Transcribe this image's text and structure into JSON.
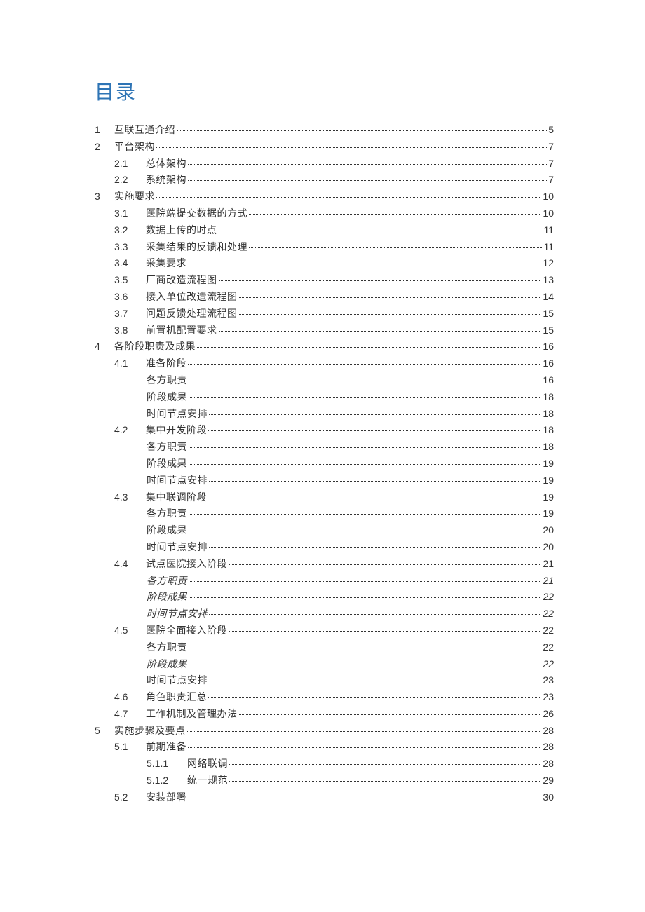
{
  "title": "目录",
  "entries": [
    {
      "level": 1,
      "num": "1",
      "text": "互联互通介绍",
      "page": "5",
      "italic": false
    },
    {
      "level": 1,
      "num": "2",
      "text": "平台架构",
      "page": "7",
      "italic": false
    },
    {
      "level": 2,
      "num": "2.1",
      "text": "总体架构",
      "page": "7",
      "italic": false
    },
    {
      "level": 2,
      "num": "2.2",
      "text": "系统架构",
      "page": "7",
      "italic": false
    },
    {
      "level": 1,
      "num": "3",
      "text": "实施要求",
      "page": "10",
      "italic": false
    },
    {
      "level": 2,
      "num": "3.1",
      "text": "医院端提交数据的方式",
      "page": "10",
      "italic": false
    },
    {
      "level": 2,
      "num": "3.2",
      "text": "数据上传的时点",
      "page": "11",
      "italic": false
    },
    {
      "level": 2,
      "num": "3.3",
      "text": "采集结果的反馈和处理",
      "page": "11",
      "italic": false
    },
    {
      "level": 2,
      "num": "3.4",
      "text": "采集要求",
      "page": "12",
      "italic": false
    },
    {
      "level": 2,
      "num": "3.5",
      "text": "厂商改造流程图",
      "page": "13",
      "italic": false
    },
    {
      "level": 2,
      "num": "3.6",
      "text": "接入单位改造流程图",
      "page": "14",
      "italic": false
    },
    {
      "level": 2,
      "num": "3.7",
      "text": "问题反馈处理流程图",
      "page": "15",
      "italic": false
    },
    {
      "level": 2,
      "num": "3.8",
      "text": "前置机配置要求",
      "page": "15",
      "italic": false
    },
    {
      "level": 1,
      "num": "4",
      "text": "各阶段职责及成果",
      "page": "16",
      "italic": false
    },
    {
      "level": 2,
      "num": "4.1",
      "text": "准备阶段",
      "page": "16",
      "italic": false
    },
    {
      "level": "2b",
      "num": "",
      "text": "各方职责",
      "page": "16",
      "italic": false
    },
    {
      "level": "2b",
      "num": "",
      "text": "阶段成果",
      "page": "18",
      "italic": false
    },
    {
      "level": "2b",
      "num": "",
      "text": "时间节点安排",
      "page": "18",
      "italic": false
    },
    {
      "level": 2,
      "num": "4.2",
      "text": "集中开发阶段",
      "page": "18",
      "italic": false
    },
    {
      "level": "2b",
      "num": "",
      "text": "各方职责",
      "page": "18",
      "italic": false
    },
    {
      "level": "2b",
      "num": "",
      "text": "阶段成果",
      "page": "19",
      "italic": false
    },
    {
      "level": "2b",
      "num": "",
      "text": "时间节点安排",
      "page": "19",
      "italic": false
    },
    {
      "level": 2,
      "num": "4.3",
      "text": "集中联调阶段",
      "page": "19",
      "italic": false
    },
    {
      "level": "2b",
      "num": "",
      "text": "各方职责",
      "page": "19",
      "italic": false
    },
    {
      "level": "2b",
      "num": "",
      "text": "阶段成果",
      "page": "20",
      "italic": false
    },
    {
      "level": "2b",
      "num": "",
      "text": "时间节点安排",
      "page": "20",
      "italic": false
    },
    {
      "level": 2,
      "num": "4.4",
      "text": "试点医院接入阶段",
      "page": "21",
      "italic": false
    },
    {
      "level": "2b",
      "num": "",
      "text": "各方职责",
      "page": "21",
      "italic": true
    },
    {
      "level": "2b",
      "num": "",
      "text": "阶段成果",
      "page": "22",
      "italic": true
    },
    {
      "level": "2b",
      "num": "",
      "text": "时间节点安排",
      "page": "22",
      "italic": true
    },
    {
      "level": 2,
      "num": "4.5",
      "text": "医院全面接入阶段",
      "page": "22",
      "italic": false
    },
    {
      "level": "2b",
      "num": "",
      "text": "各方职责",
      "page": "22",
      "italic": false
    },
    {
      "level": "2b",
      "num": "",
      "text": "阶段成果",
      "page": "22",
      "italic": true
    },
    {
      "level": "2b",
      "num": "",
      "text": "时间节点安排",
      "page": "23",
      "italic": false
    },
    {
      "level": 2,
      "num": "4.6",
      "text": "角色职责汇总",
      "page": "23",
      "italic": false
    },
    {
      "level": 2,
      "num": "4.7",
      "text": "工作机制及管理办法",
      "page": "26",
      "italic": false
    },
    {
      "level": 1,
      "num": "5",
      "text": "实施步骤及要点",
      "page": "28",
      "italic": false
    },
    {
      "level": 2,
      "num": "5.1",
      "text": "前期准备",
      "page": "28",
      "italic": false
    },
    {
      "level": 3,
      "num": "5.1.1",
      "text": "网络联调",
      "page": "28",
      "italic": false
    },
    {
      "level": 3,
      "num": "5.1.2",
      "text": "统一规范",
      "page": "29",
      "italic": false
    },
    {
      "level": 2,
      "num": "5.2",
      "text": "安装部署",
      "page": "30",
      "italic": false
    }
  ]
}
